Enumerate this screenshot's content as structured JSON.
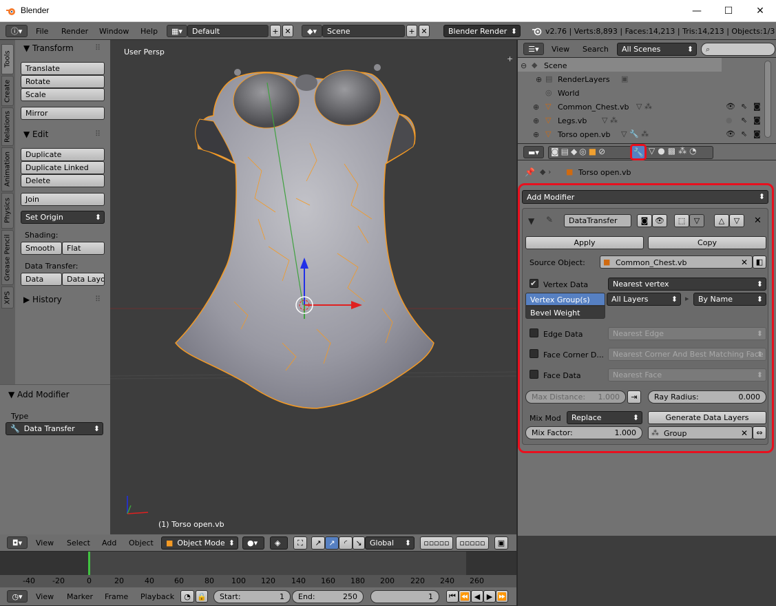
{
  "window": {
    "title": "Blender",
    "minimize": "—",
    "maximize": "☐",
    "close": "✕"
  },
  "info_header": {
    "menus": [
      "File",
      "Render",
      "Window",
      "Help"
    ],
    "screen_layout": "Default",
    "scene": "Scene",
    "render_engine": "Blender Render",
    "stats": "v2.76 | Verts:8,893 | Faces:14,213 | Tris:14,213 | Objects:1/3 | L"
  },
  "toolshelf": {
    "tabs": [
      "Tools",
      "Create",
      "Relations",
      "Animation",
      "Physics",
      "Grease Pencil",
      "XPS"
    ],
    "transform": {
      "title": "Transform",
      "buttons": [
        "Translate",
        "Rotate",
        "Scale"
      ],
      "mirror": "Mirror"
    },
    "edit": {
      "title": "Edit",
      "buttons": [
        "Duplicate",
        "Duplicate Linked",
        "Delete"
      ],
      "join": "Join",
      "set_origin": "Set Origin"
    },
    "shading": {
      "label": "Shading:",
      "smooth": "Smooth",
      "flat": "Flat"
    },
    "data_transfer": {
      "label": "Data Transfer:",
      "data": "Data",
      "data_layout": "Data Layo"
    },
    "history": "History",
    "operator": {
      "title": "Add Modifier",
      "type_label": "Type",
      "type_value": "Data Transfer"
    }
  },
  "viewport": {
    "view_name": "User Persp",
    "object_label": "(1) Torso open.vb"
  },
  "viewport_header": {
    "menus": [
      "View",
      "Select",
      "Add",
      "Object"
    ],
    "mode": "Object Mode",
    "orientation": "Global"
  },
  "timeline": {
    "ticks": [
      "-40",
      "-20",
      "0",
      "20",
      "40",
      "60",
      "80",
      "100",
      "120",
      "140",
      "160",
      "180",
      "200",
      "220",
      "240",
      "260"
    ],
    "menus": [
      "View",
      "Marker",
      "Frame",
      "Playback"
    ],
    "start_label": "Start:",
    "start_value": "1",
    "end_label": "End:",
    "end_value": "250",
    "current_frame": "1"
  },
  "outliner": {
    "menus": [
      "View",
      "Search"
    ],
    "filter": "All Scenes",
    "items": [
      {
        "name": "Scene"
      },
      {
        "name": "RenderLayers"
      },
      {
        "name": "World"
      },
      {
        "name": "Common_Chest.vb"
      },
      {
        "name": "Legs.vb"
      },
      {
        "name": "Torso open.vb"
      }
    ]
  },
  "properties": {
    "breadcrumb": "Torso open.vb",
    "add_modifier": "Add Modifier",
    "modifier": {
      "name": "DataTransfer",
      "apply": "Apply",
      "copy": "Copy",
      "source_object_label": "Source Object:",
      "source_object": "Common_Chest.vb",
      "vertex_data": {
        "label": "Vertex Data",
        "checked": true,
        "mapping": "Nearest vertex"
      },
      "vertex_types": [
        "Vertex Group(s)",
        "Bevel Weight"
      ],
      "layers_select": "All Layers",
      "layers_match": "By Name",
      "edge_data": {
        "label": "Edge Data",
        "checked": false,
        "mapping": "Nearest Edge"
      },
      "face_corner_data": {
        "label": "Face Corner D...",
        "checked": false,
        "mapping": "Nearest Corner And Best Matching Face"
      },
      "face_data": {
        "label": "Face Data",
        "checked": false,
        "mapping": "Nearest Face"
      },
      "max_distance_label": "Max Distance:",
      "max_distance": "1.000",
      "ray_radius_label": "Ray Radius:",
      "ray_radius": "0.000",
      "mix_mode_label": "Mix Mod",
      "mix_mode": "Replace",
      "generate_layers": "Generate Data Layers",
      "mix_factor_label": "Mix Factor:",
      "mix_factor": "1.000",
      "vertex_group": "Group"
    }
  },
  "colors": {
    "highlight": "#e8101e",
    "selection_orange": "#f59a23",
    "selected_blue": "#5680c2"
  }
}
